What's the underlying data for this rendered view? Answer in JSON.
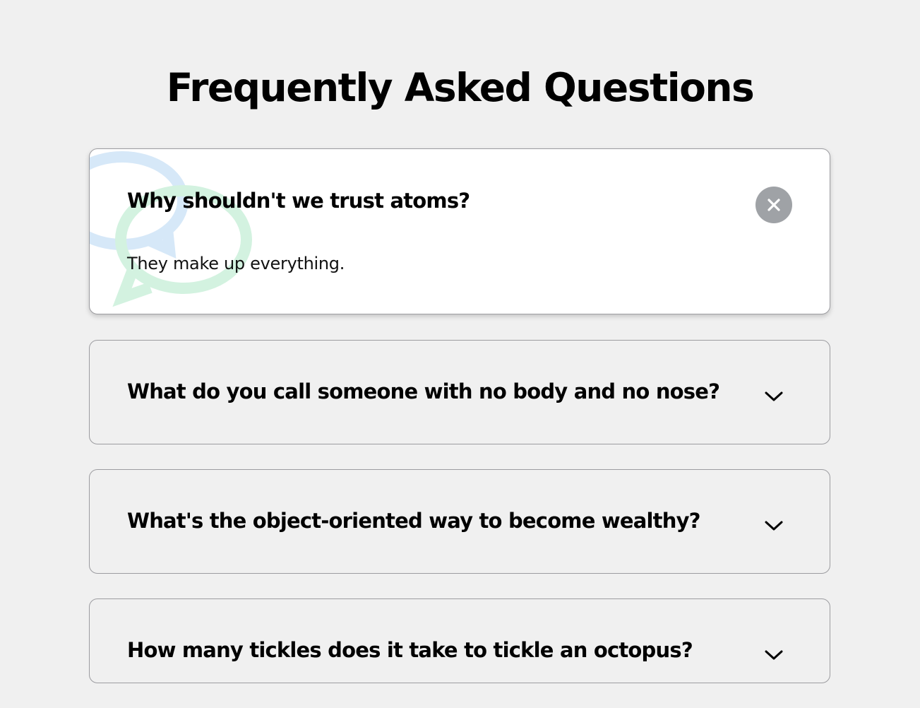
{
  "page": {
    "title": "Frequently Asked Questions"
  },
  "faqs": [
    {
      "question": "Why shouldn't we trust atoms?",
      "answer": "They make up everything.",
      "expanded": true,
      "toggle_icon": "close-icon"
    },
    {
      "question": "What do you call someone with no body and no nose?",
      "expanded": false,
      "toggle_icon": "chevron-down-icon"
    },
    {
      "question": "What's the object-oriented way to become wealthy?",
      "expanded": false,
      "toggle_icon": "chevron-down-icon"
    },
    {
      "question": "How many tickles does it take to tickle an octopus?",
      "expanded": false,
      "toggle_icon": "chevron-down-icon"
    }
  ],
  "colors": {
    "background": "#f0f0f0",
    "card_active": "#ffffff",
    "border": "#9c9ca0",
    "close_button": "#9fa2a6",
    "bubble_blue": "#d6e8f8",
    "bubble_green": "#d3f2e0"
  },
  "icons": {
    "decoration": "chat-bubbles-icon"
  }
}
